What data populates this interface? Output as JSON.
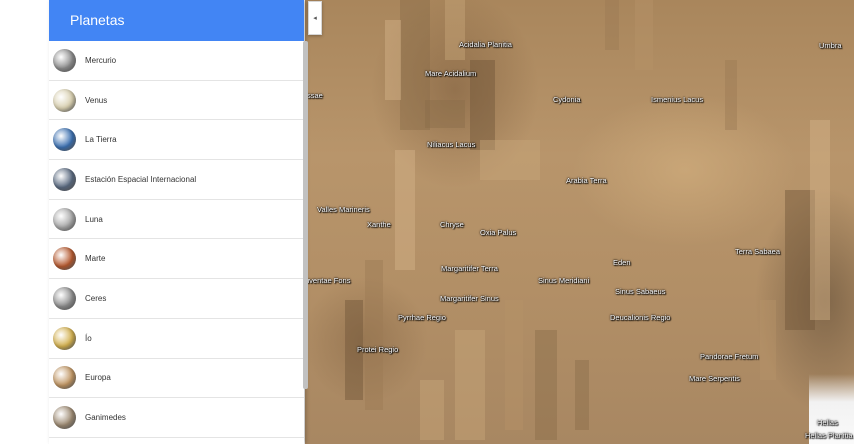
{
  "sidebar": {
    "title": "Planetas",
    "items": [
      {
        "label": "Mercurio",
        "icon": "mercury-icon",
        "color": "#8d8d8d"
      },
      {
        "label": "Venus",
        "icon": "venus-icon",
        "color": "#d9d0b0"
      },
      {
        "label": "La Tierra",
        "icon": "earth-icon",
        "color": "#3a6fb0"
      },
      {
        "label": "Estación Espacial Internacional",
        "icon": "space-station-icon",
        "color": "#5a6a80"
      },
      {
        "label": "Luna",
        "icon": "moon-icon",
        "color": "#a8a8a8"
      },
      {
        "label": "Marte",
        "icon": "mars-icon",
        "color": "#b5582e"
      },
      {
        "label": "Ceres",
        "icon": "ceres-icon",
        "color": "#8e8e8e"
      },
      {
        "label": "Ío",
        "icon": "io-icon",
        "color": "#d3b04e"
      },
      {
        "label": "Europa",
        "icon": "europa-icon",
        "color": "#c09562"
      },
      {
        "label": "Ganimedes",
        "icon": "ganymede-icon",
        "color": "#9d8a72"
      }
    ]
  },
  "collapse_button": {
    "glyph": "◂",
    "icon": "chevron-left-icon"
  },
  "map": {
    "labels": [
      "Acidalia Planitia",
      "Mare Acidalium",
      "Cydonia",
      "Ismenius Lacus",
      "Umbra",
      "ssae",
      "Niliacus Lacus",
      "Arabia Terra",
      "Valles Marineris",
      "Xanthe",
      "Chryse",
      "Oxia Palus",
      "Eden",
      "Terra Sabaea",
      "Margaritifer Terra",
      "uventae Fons",
      "Sinus Meridiani",
      "Sinus Sabaeus",
      "Margaritifer Sinus",
      "Pyrrhae Regio",
      "Deucalionis Regio",
      "Protei Regio",
      "Pandorae Fretum",
      "Mare Serpentis",
      "Hellas",
      "Hellas Planitia"
    ]
  }
}
